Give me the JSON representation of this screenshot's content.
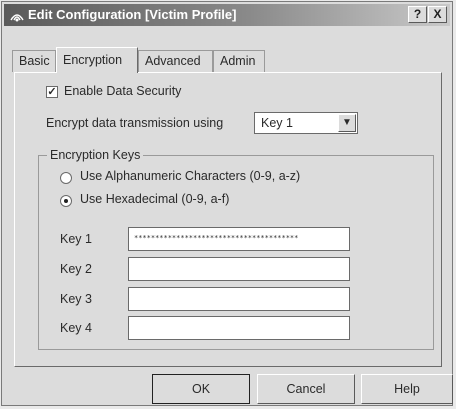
{
  "window": {
    "title": "Edit Configuration [Victim Profile]",
    "help_label": "?",
    "close_label": "X"
  },
  "tabs": [
    {
      "label": "Basic",
      "active": false
    },
    {
      "label": "Encryption",
      "active": true
    },
    {
      "label": "Advanced",
      "active": false
    },
    {
      "label": "Admin",
      "active": false
    }
  ],
  "encryption": {
    "enable_label": "Enable Data Security",
    "enable_checked": true,
    "encrypt_using_label": "Encrypt data transmission using",
    "encrypt_using_value": "Key 1",
    "group_label": "Encryption Keys",
    "radio_alnum_label": "Use Alphanumeric Characters (0-9, a-z)",
    "radio_hex_label": "Use Hexadecimal (0-9, a-f)",
    "selected_format": "hex",
    "keys": [
      {
        "label": "Key 1",
        "value": "***************************************"
      },
      {
        "label": "Key 2",
        "value": ""
      },
      {
        "label": "Key 3",
        "value": ""
      },
      {
        "label": "Key 4",
        "value": ""
      }
    ]
  },
  "buttons": {
    "ok": "OK",
    "cancel": "Cancel",
    "help": "Help"
  },
  "icons": {
    "title": "wireless-signal-icon",
    "dropdown": "chevron-down-icon",
    "check": "check-icon"
  }
}
